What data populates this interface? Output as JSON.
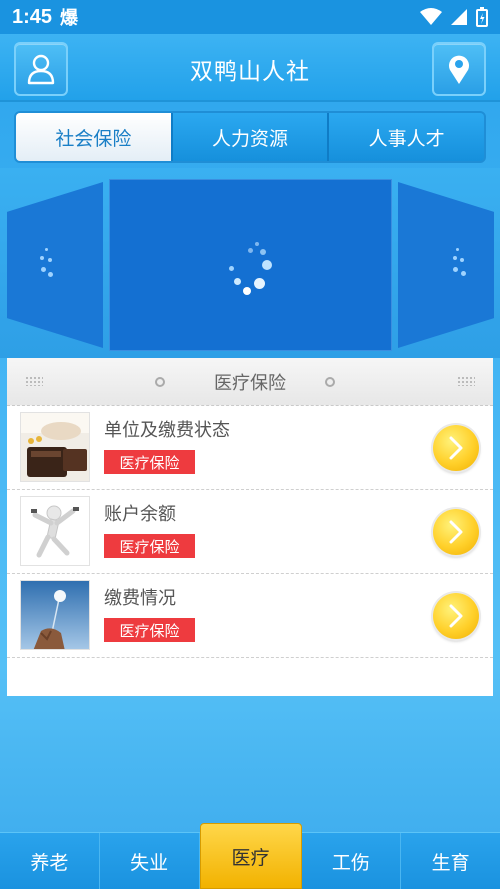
{
  "status_bar": {
    "time": "1:45",
    "app_indicator": "爆"
  },
  "header": {
    "title": "双鸭山人社",
    "left_icon": "user-icon",
    "right_icon": "location-pin-icon"
  },
  "tabs": [
    {
      "label": "社会保险",
      "active": true
    },
    {
      "label": "人力资源",
      "active": false
    },
    {
      "label": "人事人才",
      "active": false
    }
  ],
  "panel": {
    "title": "医疗保险",
    "items": [
      {
        "title": "单位及缴费状态",
        "badge": "医疗保险"
      },
      {
        "title": "账户余额",
        "badge": "医疗保险"
      },
      {
        "title": "缴费情况",
        "badge": "医疗保险"
      }
    ]
  },
  "bottom_nav": [
    {
      "label": "养老",
      "active": false
    },
    {
      "label": "失业",
      "active": false
    },
    {
      "label": "医疗",
      "active": true
    },
    {
      "label": "工伤",
      "active": false
    },
    {
      "label": "生育",
      "active": false
    }
  ],
  "colors": {
    "primary_blue": "#22a1ea",
    "badge_red": "#ee3b3f",
    "active_yellow": "#ffd02a"
  }
}
